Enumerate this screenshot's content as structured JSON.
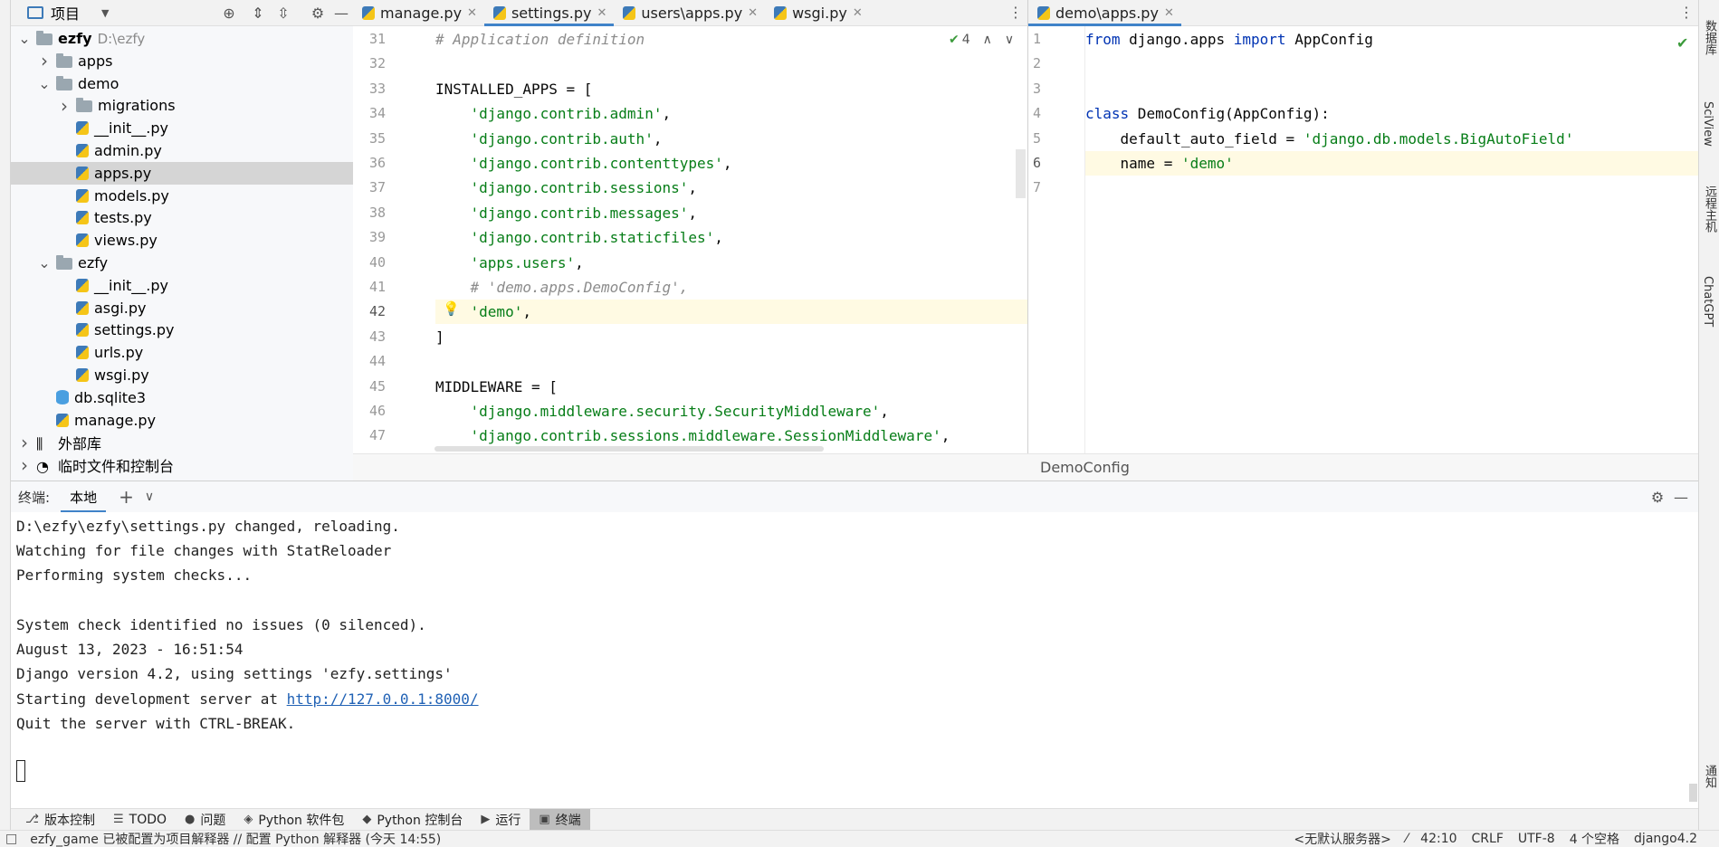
{
  "project_panel": {
    "title": "项目",
    "tree": [
      {
        "label": "ezfy",
        "hint": "D:\\ezfy",
        "type": "folder",
        "expanded": true,
        "level": 0
      },
      {
        "label": "apps",
        "type": "folder",
        "expanded": false,
        "level": 1
      },
      {
        "label": "demo",
        "type": "folder",
        "expanded": true,
        "level": 1
      },
      {
        "label": "migrations",
        "type": "folder",
        "expanded": false,
        "level": 2
      },
      {
        "label": "__init__.py",
        "type": "py",
        "level": 2
      },
      {
        "label": "admin.py",
        "type": "py",
        "level": 2
      },
      {
        "label": "apps.py",
        "type": "py",
        "level": 2,
        "selected": true
      },
      {
        "label": "models.py",
        "type": "py",
        "level": 2
      },
      {
        "label": "tests.py",
        "type": "py",
        "level": 2
      },
      {
        "label": "views.py",
        "type": "py",
        "level": 2
      },
      {
        "label": "ezfy",
        "type": "folder",
        "expanded": true,
        "level": 1
      },
      {
        "label": "__init__.py",
        "type": "py",
        "level": 2
      },
      {
        "label": "asgi.py",
        "type": "py",
        "level": 2
      },
      {
        "label": "settings.py",
        "type": "py",
        "level": 2
      },
      {
        "label": "urls.py",
        "type": "py",
        "level": 2
      },
      {
        "label": "wsgi.py",
        "type": "py",
        "level": 2
      },
      {
        "label": "db.sqlite3",
        "type": "db",
        "level": 1
      },
      {
        "label": "manage.py",
        "type": "py",
        "level": 1
      },
      {
        "label": "外部库",
        "type": "lib",
        "expanded": false,
        "level": 0
      },
      {
        "label": "临时文件和控制台",
        "type": "scratch",
        "expanded": false,
        "level": 0
      }
    ]
  },
  "left_editor": {
    "tabs": [
      {
        "label": "manage.py",
        "active": false
      },
      {
        "label": "settings.py",
        "active": true
      },
      {
        "label": "users\\apps.py",
        "active": false
      },
      {
        "label": "wsgi.py",
        "active": false
      }
    ],
    "inspection_count": "4",
    "lines": [
      {
        "n": "31",
        "text": "# Application definition"
      },
      {
        "n": "32",
        "text": ""
      },
      {
        "n": "33",
        "text": "INSTALLED_APPS = ["
      },
      {
        "n": "34",
        "text": "    'django.contrib.admin',"
      },
      {
        "n": "35",
        "text": "    'django.contrib.auth',"
      },
      {
        "n": "36",
        "text": "    'django.contrib.contenttypes',"
      },
      {
        "n": "37",
        "text": "    'django.contrib.sessions',"
      },
      {
        "n": "38",
        "text": "    'django.contrib.messages',"
      },
      {
        "n": "39",
        "text": "    'django.contrib.staticfiles',"
      },
      {
        "n": "40",
        "text": "    'apps.users',"
      },
      {
        "n": "41",
        "text": "    # 'demo.apps.DemoConfig',"
      },
      {
        "n": "42",
        "text": "    'demo',"
      },
      {
        "n": "43",
        "text": "]"
      },
      {
        "n": "44",
        "text": ""
      },
      {
        "n": "45",
        "text": "MIDDLEWARE = ["
      },
      {
        "n": "46",
        "text": "    'django.middleware.security.SecurityMiddleware',"
      },
      {
        "n": "47",
        "text": "    'django.contrib.sessions.middleware.SessionMiddleware',"
      }
    ]
  },
  "right_editor": {
    "tabs": [
      {
        "label": "demo\\apps.py",
        "active": true
      }
    ],
    "lines": [
      {
        "n": "1",
        "text": "from django.apps import AppConfig"
      },
      {
        "n": "2",
        "text": ""
      },
      {
        "n": "3",
        "text": ""
      },
      {
        "n": "4",
        "text": "class DemoConfig(AppConfig):"
      },
      {
        "n": "5",
        "text": "    default_auto_field = 'django.db.models.BigAutoField'"
      },
      {
        "n": "6",
        "text": "    name = 'demo'"
      },
      {
        "n": "7",
        "text": ""
      }
    ],
    "breadcrumb": "DemoConfig"
  },
  "terminal": {
    "title": "终端:",
    "tab": "本地",
    "lines": [
      "D:\\ezfy\\ezfy\\settings.py changed, reloading.",
      "Watching for file changes with StatReloader",
      "Performing system checks...",
      "",
      "System check identified no issues (0 silenced).",
      "August 13, 2023 - 16:51:54",
      "Django version 4.2, using settings 'ezfy.settings'"
    ],
    "server_prefix": "Starting development server at ",
    "server_url": "http://127.0.0.1:8000/",
    "quit_line": "Quit the server with CTRL-BREAK."
  },
  "tool_windows": [
    {
      "label": "版本控制",
      "icon": "vcs-icon",
      "active": false
    },
    {
      "label": "TODO",
      "icon": "todo-icon",
      "active": false
    },
    {
      "label": "问题",
      "icon": "problems-icon",
      "active": false
    },
    {
      "label": "Python 软件包",
      "icon": "packages-icon",
      "active": false
    },
    {
      "label": "Python 控制台",
      "icon": "python-console-icon",
      "active": false
    },
    {
      "label": "运行",
      "icon": "run-icon",
      "active": false
    },
    {
      "label": "终端",
      "icon": "terminal-icon",
      "active": true
    }
  ],
  "status_bar": {
    "message": "ezfy_game 已被配置为项目解释器 // 配置 Python 解释器 (今天 14:55)",
    "server": "<无默认服务器>",
    "position": "42:10",
    "line_sep": "CRLF",
    "encoding": "UTF-8",
    "indent": "4 个空格",
    "interpreter": "django4.2"
  },
  "right_sidebar": [
    "数据库",
    "SciView",
    "远程主机",
    "ChatGPT",
    "通知"
  ],
  "colors": {
    "accent": "#4083c9",
    "string": "#067d17",
    "keyword": "#0033b3",
    "comment": "#8c8c8c",
    "selection": "#d5d5d5"
  }
}
